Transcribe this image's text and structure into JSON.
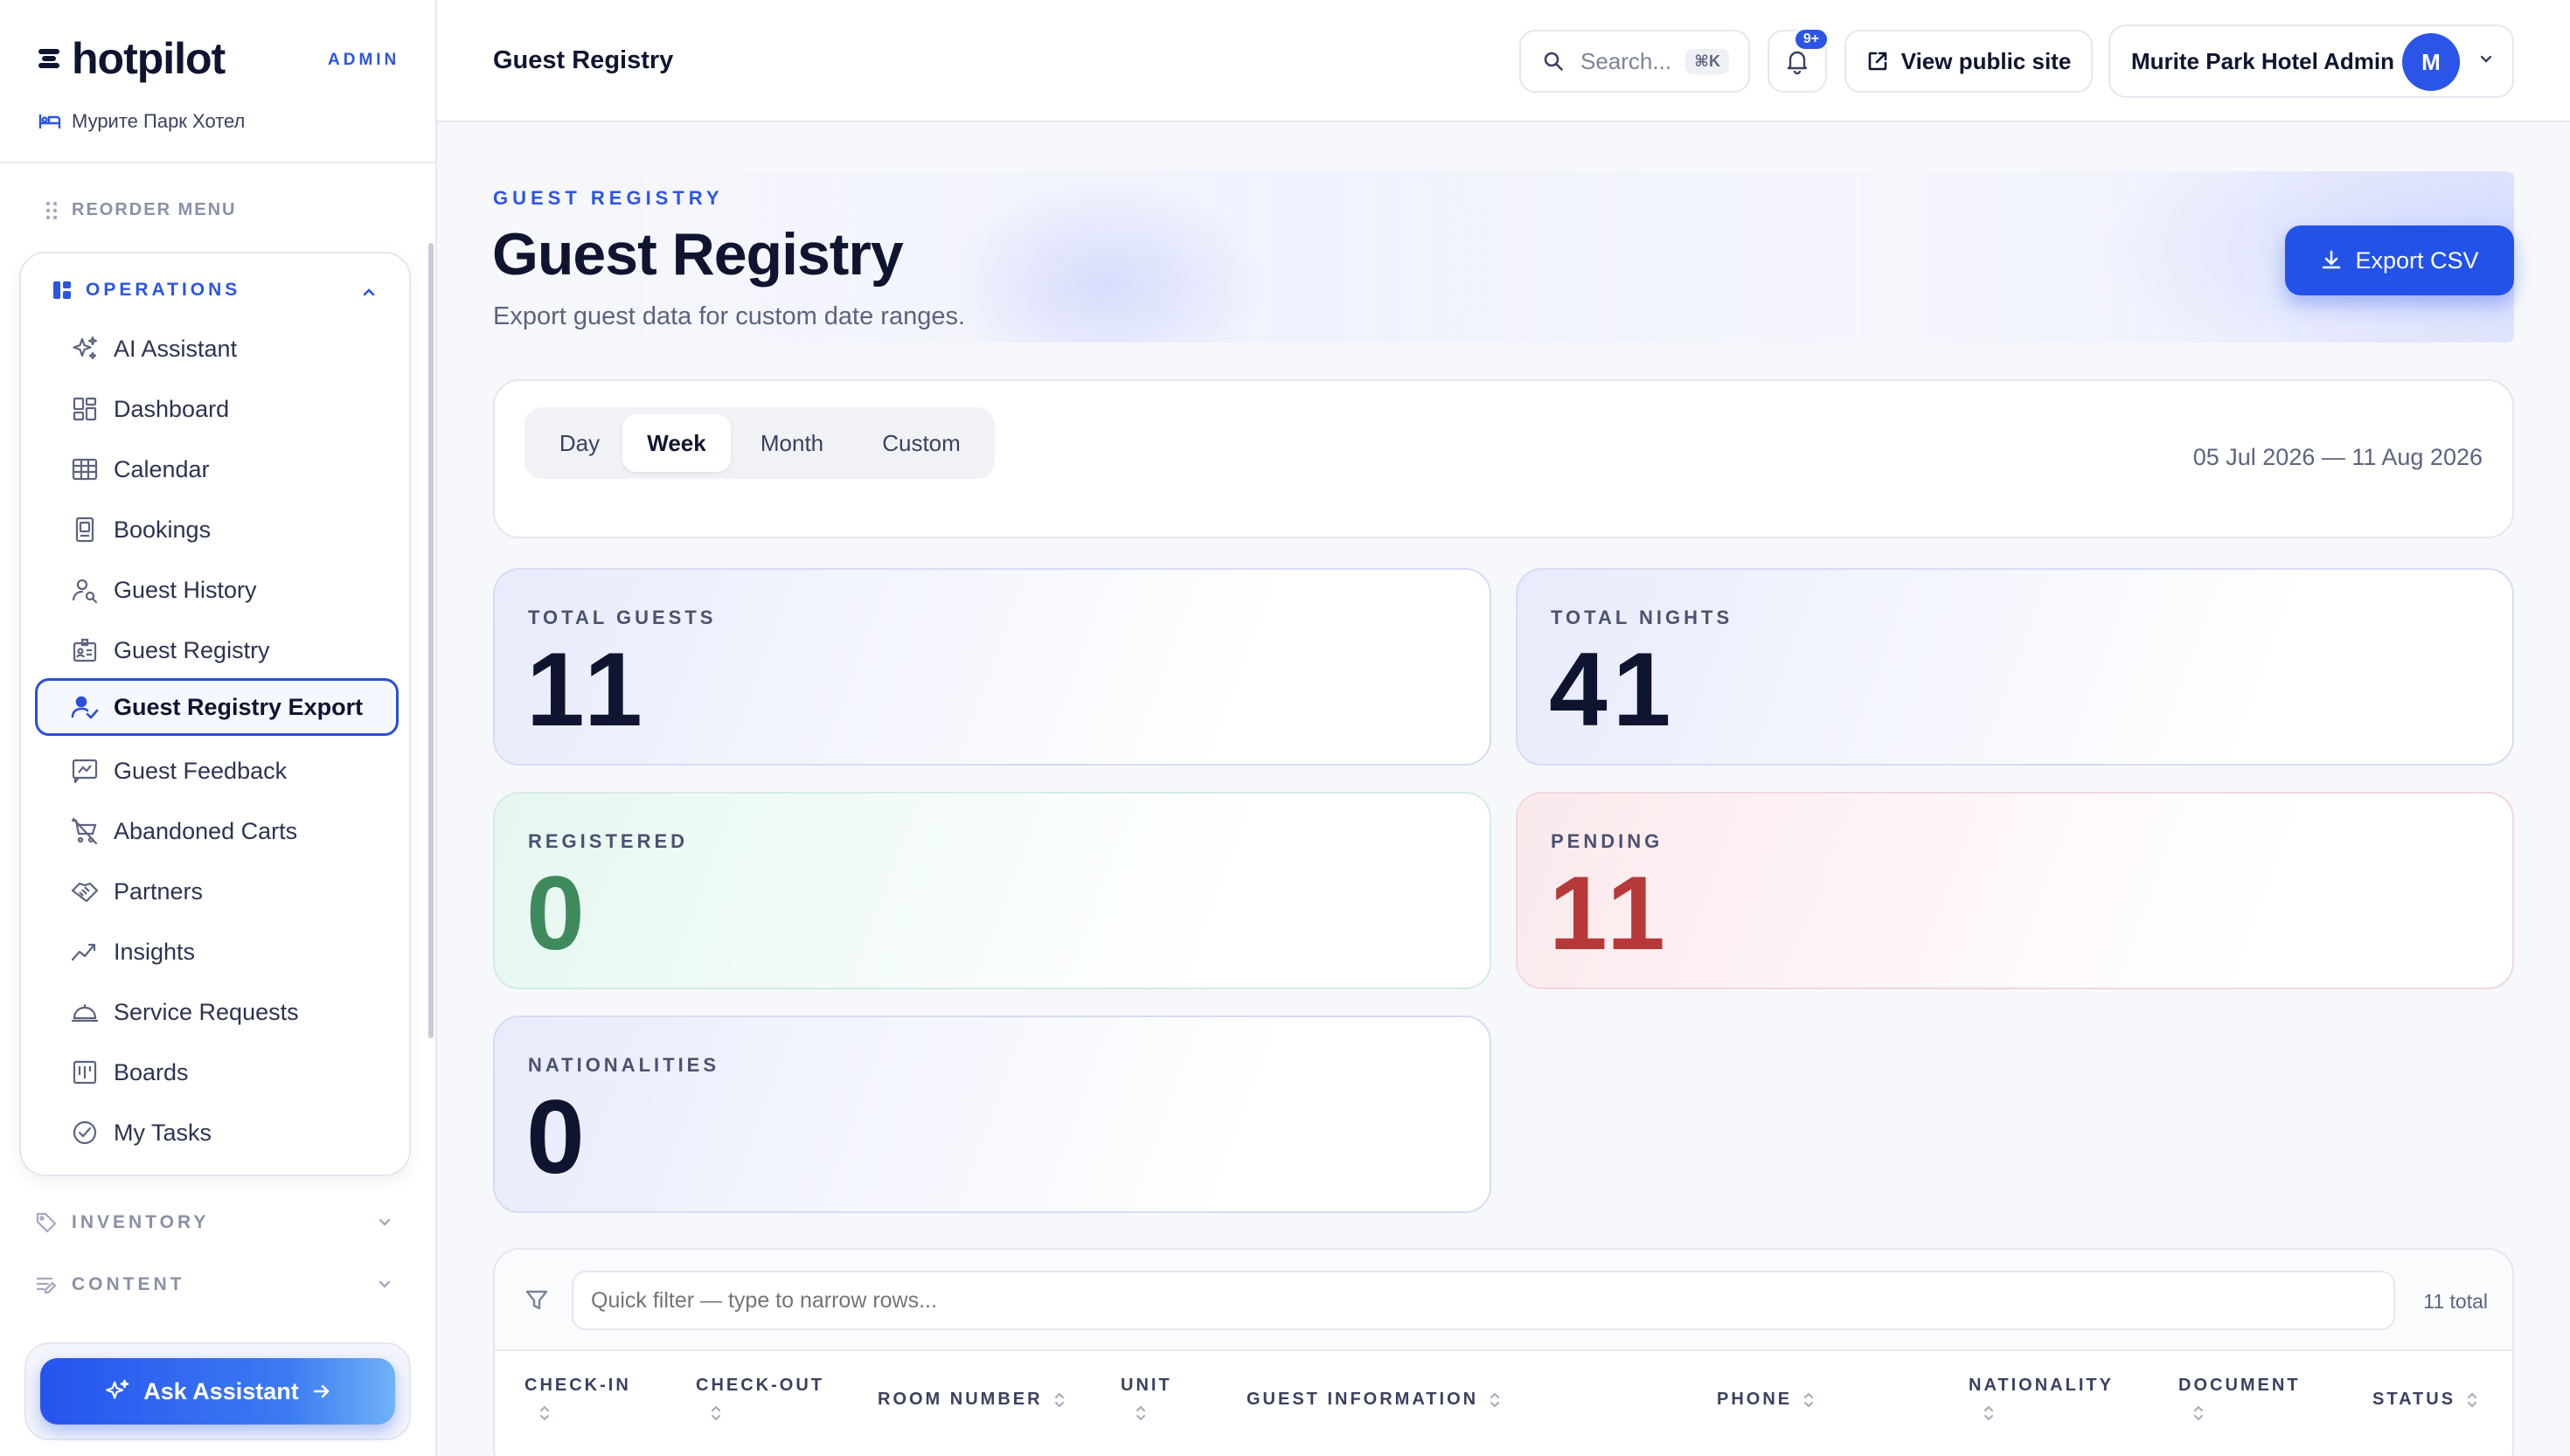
{
  "brand": {
    "name": "hotpilot",
    "tag": "ADMIN",
    "hotel": "Мурите Парк Хотел"
  },
  "sidebar": {
    "reorder_label": "REORDER MENU",
    "groups": [
      {
        "label": "OPERATIONS",
        "expanded": true
      },
      {
        "label": "INVENTORY",
        "expanded": false
      },
      {
        "label": "CONTENT",
        "expanded": false
      }
    ],
    "items": [
      {
        "label": "AI Assistant",
        "icon": "sparkle-icon"
      },
      {
        "label": "Dashboard",
        "icon": "dashboard-icon"
      },
      {
        "label": "Calendar",
        "icon": "calendar-grid-icon"
      },
      {
        "label": "Bookings",
        "icon": "booking-doc-icon"
      },
      {
        "label": "Guest History",
        "icon": "user-search-icon"
      },
      {
        "label": "Guest Registry",
        "icon": "id-card-icon"
      },
      {
        "label": "Guest Registry Export",
        "icon": "user-check-icon",
        "active": true
      },
      {
        "label": "Guest Feedback",
        "icon": "feedback-icon"
      },
      {
        "label": "Abandoned Carts",
        "icon": "cart-off-icon"
      },
      {
        "label": "Partners",
        "icon": "handshake-icon"
      },
      {
        "label": "Insights",
        "icon": "trend-icon"
      },
      {
        "label": "Service Requests",
        "icon": "service-bell-icon"
      },
      {
        "label": "Boards",
        "icon": "board-icon"
      },
      {
        "label": "My Tasks",
        "icon": "check-circle-icon"
      }
    ],
    "assistant_label": "Ask Assistant"
  },
  "topbar": {
    "title": "Guest Registry",
    "search_placeholder": "Search...",
    "search_shortcut": "⌘K",
    "notifications_badge": "9+",
    "public_site_label": "View public site",
    "user_name": "Murite Park Hotel Admin",
    "avatar_initial": "M"
  },
  "page": {
    "eyebrow": "GUEST REGISTRY",
    "title": "Guest Registry",
    "subtitle": "Export guest data for custom date ranges.",
    "export_label": "Export CSV"
  },
  "range": {
    "options": [
      "Day",
      "Week",
      "Month",
      "Custom"
    ],
    "selected": "Week",
    "date_range": "05 Jul 2026 — 11 Aug 2026"
  },
  "stats": {
    "total_guests": {
      "label": "TOTAL GUESTS",
      "value": "11"
    },
    "total_nights": {
      "label": "TOTAL NIGHTS",
      "value": "41"
    },
    "registered": {
      "label": "REGISTERED",
      "value": "0"
    },
    "pending": {
      "label": "PENDING",
      "value": "11"
    },
    "nationalities": {
      "label": "NATIONALITIES",
      "value": "0"
    }
  },
  "colors": {
    "accent": "#2b55e6",
    "registered": "#3f8a5c",
    "pending": "#b73838",
    "ink": "#0f1530"
  },
  "table": {
    "filter_placeholder": "Quick filter — type to narrow rows...",
    "total_label": "11 total",
    "columns": [
      "CHECK-IN",
      "CHECK-OUT",
      "ROOM NUMBER",
      "UNIT",
      "GUEST INFORMATION",
      "PHONE",
      "NATIONALITY",
      "DOCUMENT",
      "STATUS"
    ]
  }
}
